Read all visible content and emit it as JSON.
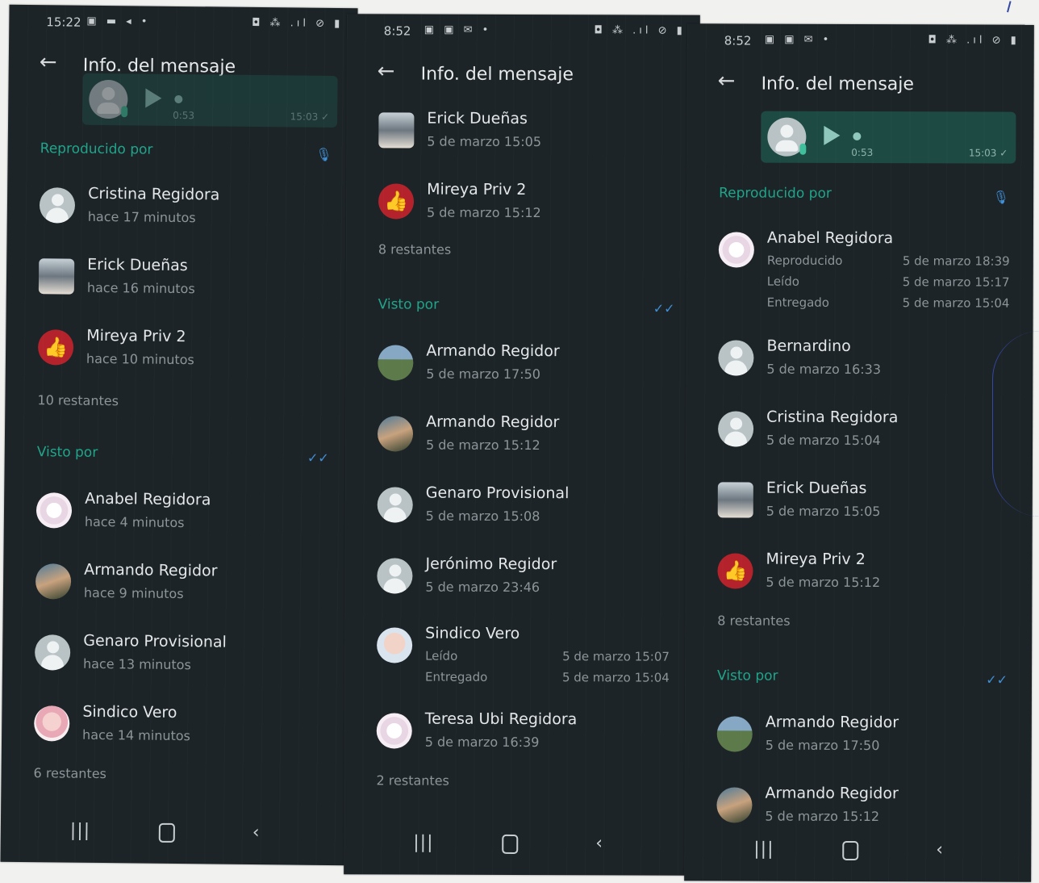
{
  "screens": [
    {
      "status": {
        "time": "15:22",
        "left_icons": "▣ ▬ ◂ •",
        "right_icons": "◘ ⁂ .ıl ⊘ ▮"
      },
      "title": "Info. del mensaje",
      "bubble": {
        "duration": "0:53",
        "sent": "15:03 ✓"
      },
      "played": {
        "label": "Reproducido por",
        "icon": "mic-icon",
        "rows": [
          {
            "name": "Cristina Regidora",
            "time": "hace 17 minutos"
          },
          {
            "name": "Erick Dueñas",
            "time": "hace 16 minutos"
          },
          {
            "name": "Mireya Priv 2",
            "time": "hace 10 minutos"
          }
        ],
        "remaining": "10 restantes"
      },
      "seen": {
        "label": "Visto por",
        "icon": "double-check-icon",
        "rows": [
          {
            "name": "Anabel Regidora",
            "time": "hace 4 minutos"
          },
          {
            "name": "Armando Regidor",
            "time": "hace 9 minutos"
          },
          {
            "name": "Genaro Provisional",
            "time": "hace 13 minutos"
          },
          {
            "name": "Sindico Vero",
            "time": "hace 14 minutos"
          }
        ],
        "remaining": "6 restantes"
      }
    },
    {
      "status": {
        "time": "8:52",
        "left_icons": "▣ ▣ ✉ •",
        "right_icons": "◘ ⁂ .ıl ⊘ ▮"
      },
      "title": "Info. del mensaje",
      "top_rows": [
        {
          "name": "Erick Dueñas",
          "time": "5 de marzo 15:05"
        },
        {
          "name": "Mireya Priv 2",
          "time": "5 de marzo 15:12"
        }
      ],
      "top_remaining": "8 restantes",
      "seen": {
        "label": "Visto por",
        "icon": "double-check-icon",
        "rows": [
          {
            "name": "Armando Regidor",
            "time": "5 de marzo 17:50"
          },
          {
            "name": "Armando Regidor",
            "time": "5 de marzo 15:12"
          },
          {
            "name": "Genaro Provisional",
            "time": "5 de marzo 15:08"
          },
          {
            "name": "Jerónimo Regidor",
            "time": "5 de marzo 23:46"
          }
        ]
      },
      "detail_row": {
        "name": "Sindico Vero",
        "l1": "Leído",
        "d1": "5 de marzo 15:07",
        "l2": "Entregado",
        "d2": "5 de marzo 15:04"
      },
      "last_row": {
        "name": "Teresa Ubi Regidora",
        "time": "5 de marzo 16:39"
      },
      "remaining": "2 restantes"
    },
    {
      "status": {
        "time": "8:52",
        "left_icons": "▣ ▣ ✉ •",
        "right_icons": "◘ ⁂ .ıl ⊘ ▮"
      },
      "title": "Info. del mensaje",
      "bubble": {
        "duration": "0:53",
        "sent": "15:03 ✓"
      },
      "played": {
        "label": "Reproducido por",
        "icon": "mic-icon",
        "detail_row": {
          "name": "Anabel Regidora",
          "l1": "Reproducido",
          "d1": "5 de marzo 18:39",
          "l2": "Leído",
          "d2": "5 de marzo 15:17",
          "l3": "Entregado",
          "d3": "5 de marzo 15:04"
        },
        "rows": [
          {
            "name": "Bernardino",
            "time": "5 de marzo 16:33"
          },
          {
            "name": "Cristina Regidora",
            "time": "5 de marzo 15:04"
          },
          {
            "name": "Erick Dueñas",
            "time": "5 de marzo 15:05"
          },
          {
            "name": "Mireya Priv 2",
            "time": "5 de marzo 15:12"
          }
        ],
        "remaining": "8 restantes"
      },
      "seen": {
        "label": "Visto por",
        "icon": "double-check-icon",
        "rows": [
          {
            "name": "Armando Regidor",
            "time": "5 de marzo 17:50"
          },
          {
            "name": "Armando Regidor",
            "time": "5 de marzo 15:12"
          }
        ]
      }
    }
  ],
  "nav": {
    "recent": "|||",
    "back": "‹"
  },
  "colors": {
    "background": "#1d2428",
    "accent": "#1fa58a",
    "bubble": "#1e4a44",
    "tick_blue": "#3f8fd6"
  }
}
